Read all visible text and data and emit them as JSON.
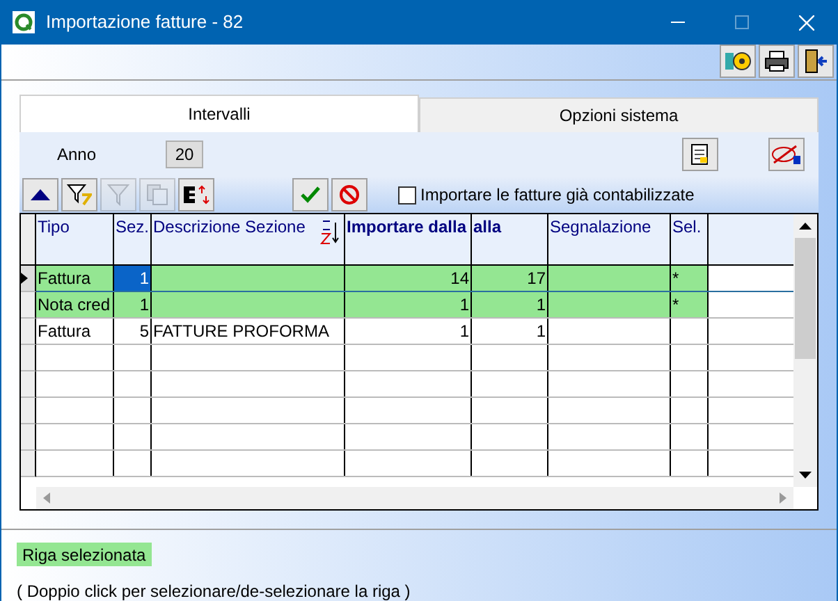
{
  "window": {
    "title": "Importazione fatture - 82"
  },
  "tabs": [
    {
      "label": "Intervalli",
      "selected": true
    },
    {
      "label": "Opzioni sistema",
      "selected": false
    }
  ],
  "anno": {
    "label": "Anno",
    "value": "20"
  },
  "toolbar": {
    "checkbox": {
      "label": "Importare le fatture già contabilizzate",
      "checked": false
    }
  },
  "table": {
    "columns": [
      {
        "label": "Tipo",
        "bold": false
      },
      {
        "label": "Sez.",
        "bold": false
      },
      {
        "label": "Descrizione Sezione",
        "bold": false,
        "sortable": true
      },
      {
        "label": "Importare dalla",
        "bold": true
      },
      {
        "label": "alla",
        "bold": true
      },
      {
        "label": "Segnalazione",
        "bold": false
      },
      {
        "label": "Sel.",
        "bold": false
      }
    ],
    "rows": [
      {
        "cells": [
          "Fattura",
          "1",
          "",
          "14",
          "17",
          "",
          "*"
        ],
        "selected": true,
        "current": true
      },
      {
        "cells": [
          "Nota cred",
          "1",
          "",
          "1",
          "1",
          "",
          "*"
        ],
        "selected": true,
        "current": false
      },
      {
        "cells": [
          "Fattura",
          "5",
          "FATTURE PROFORMA",
          "1",
          "1",
          "",
          ""
        ],
        "selected": false,
        "current": false
      }
    ]
  },
  "legend": {
    "label": "Riga selezionata",
    "hint": "( Doppio click per selezionare/de-selezionare la riga )"
  }
}
